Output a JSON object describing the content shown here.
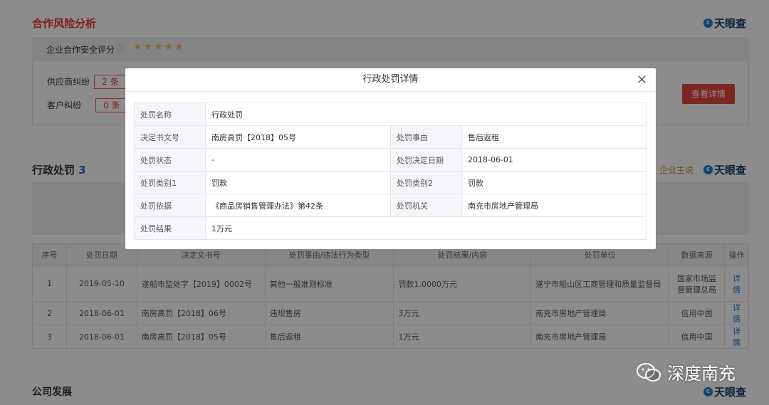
{
  "sections": {
    "coop": {
      "title": "合作风险分析",
      "score_label": "企业合作安全评分",
      "supplier_label": "供应商纠纷",
      "supplier_count": "2 条",
      "customer_label": "客户纠纷",
      "customer_count": "0 条",
      "view_btn": "查看详情"
    },
    "admin": {
      "title": "行政处罚",
      "count": "3",
      "sponsor": "企业主说"
    },
    "dev": {
      "title": "公司发展"
    }
  },
  "logo": "天眼查",
  "table": {
    "headers": [
      "序号",
      "处罚日期",
      "决定文书号",
      "处罚事由/违法行为类型",
      "处罚结果/内容",
      "处罚单位",
      "数据来源",
      "操作"
    ],
    "rows": [
      [
        "1",
        "2019-05-10",
        "遂船市监处字【2019】0002号",
        "其他一般准则标准",
        "罚款1.0000万元",
        "遂宁市船山区工商管理和质量监督局",
        "国家市场监督管理总局",
        "详情"
      ],
      [
        "2",
        "2018-06-01",
        "南房高罚【2018】06号",
        "违规售房",
        "3万元",
        "南充市房地产管理局",
        "信用中国",
        "详情"
      ],
      [
        "3",
        "2018-06-01",
        "南房高罚【2018】05号",
        "售后返租",
        "1万元",
        "南充市房地产管理局",
        "信用中国",
        "详情"
      ]
    ]
  },
  "modal": {
    "title": "行政处罚详情",
    "close": "×",
    "name_k": "处罚名称",
    "name_v": "行政处罚",
    "doc_k": "决定书文号",
    "doc_v": "南房高罚【2018】05号",
    "reason_k": "处罚事由",
    "reason_v": "售后返租",
    "status_k": "处罚状态",
    "status_v": "-",
    "date_k": "处罚决定日期",
    "date_v": "2018-06-01",
    "type1_k": "处罚类别1",
    "type1_v": "罚款",
    "type2_k": "处罚类别2",
    "type2_v": "罚款",
    "basis_k": "处罚依据",
    "basis_v": "《商品房销售管理办法》第42条",
    "org_k": "处罚机关",
    "org_v": "南充市房地产管理局",
    "result_k": "处罚结果",
    "result_v": "1万元"
  },
  "watermark": "深度南充"
}
